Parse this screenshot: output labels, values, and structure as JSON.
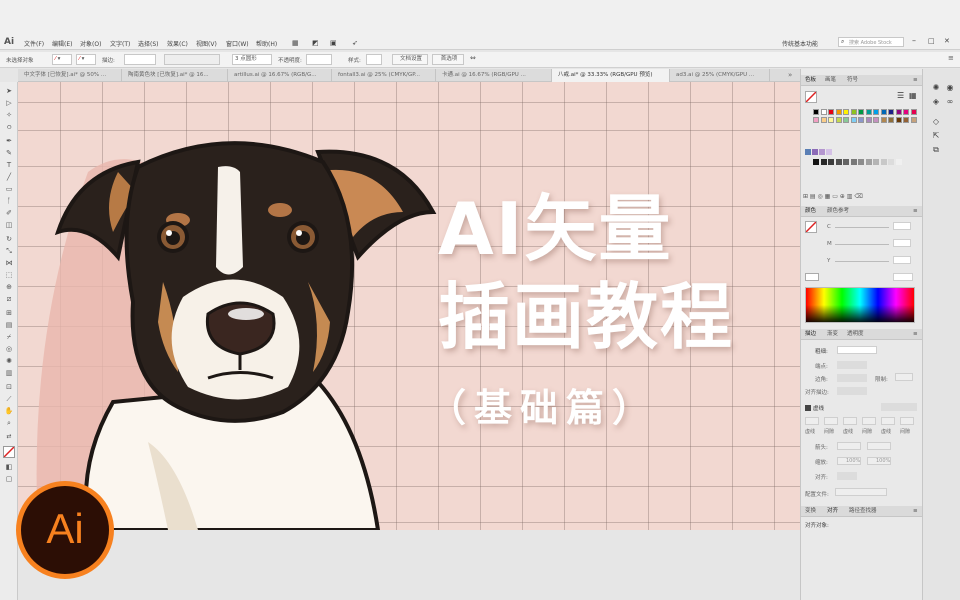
{
  "app": {
    "logo": "Ai",
    "workspace": "传统基本功能",
    "search_placeholder": "搜索 Adobe Stock"
  },
  "menus": [
    "文件(F)",
    "编辑(E)",
    "对象(O)",
    "文字(T)",
    "选择(S)",
    "效果(C)",
    "视图(V)",
    "窗口(W)",
    "帮助(H)"
  ],
  "control_bar": {
    "selection": "未选择对象",
    "stroke_label": "描边:",
    "brush": "3 点圆形",
    "opacity_label": "不透明度:",
    "style_label": "样式:",
    "doc_setup": "文档设置",
    "prefs": "首选项"
  },
  "tabs": [
    {
      "label": "中文字体 [已恢复].ai* @ 50% ...",
      "active": false
    },
    {
      "label": "陶南黄色块 [已恢复].ai* @ 16...",
      "active": false
    },
    {
      "label": "artillus.ai @ 16.67% (RGB/G...",
      "active": false
    },
    {
      "label": "fontall3.ai @ 25% (CMYK/GP...",
      "active": false
    },
    {
      "label": "卡通.ai @ 16.67% (RGB/GPU ...",
      "active": false
    },
    {
      "label": "八戒.ai* @ 33.33% (RGB/GPU 预览)",
      "active": true
    },
    {
      "label": "ad3.ai @ 25% (CMYK/GPU ...",
      "active": false
    }
  ],
  "artwork": {
    "title_line1": "AI矢量",
    "title_line2": "插画教程",
    "title_line3": "（基础篇）",
    "logo_text": "Ai"
  },
  "panels": {
    "swatches_tabs": [
      "色板",
      "画笔",
      "符号"
    ],
    "color_tabs": [
      "颜色",
      "颜色参考"
    ],
    "color_fields": [
      "C",
      "M",
      "Y"
    ],
    "stroke_tabs": [
      "描边",
      "渐变",
      "透明度"
    ],
    "stroke_weight_label": "粗细:",
    "stroke_rows": [
      "端点:",
      "边角:",
      "对齐描边:"
    ],
    "limit_label": "限制:",
    "dash_label": "虚线",
    "dash_cols": [
      "虚线",
      "间隙",
      "虚线",
      "间隙",
      "虚线",
      "间隙"
    ],
    "arrow_label": "箭头:",
    "scale_label": "缩放:",
    "scale_value_1": "100%",
    "scale_value_2": "100%",
    "align_label": "对齐:",
    "profile_label": "配置文件:",
    "bottom_tabs": [
      "变换",
      "对齐",
      "路径查找器"
    ],
    "align_objects": "对齐对象:"
  },
  "colors": {
    "canvas_bg": "#f2d8d1",
    "logo_bg": "#2c0e05",
    "logo_accent": "#f7811f"
  }
}
